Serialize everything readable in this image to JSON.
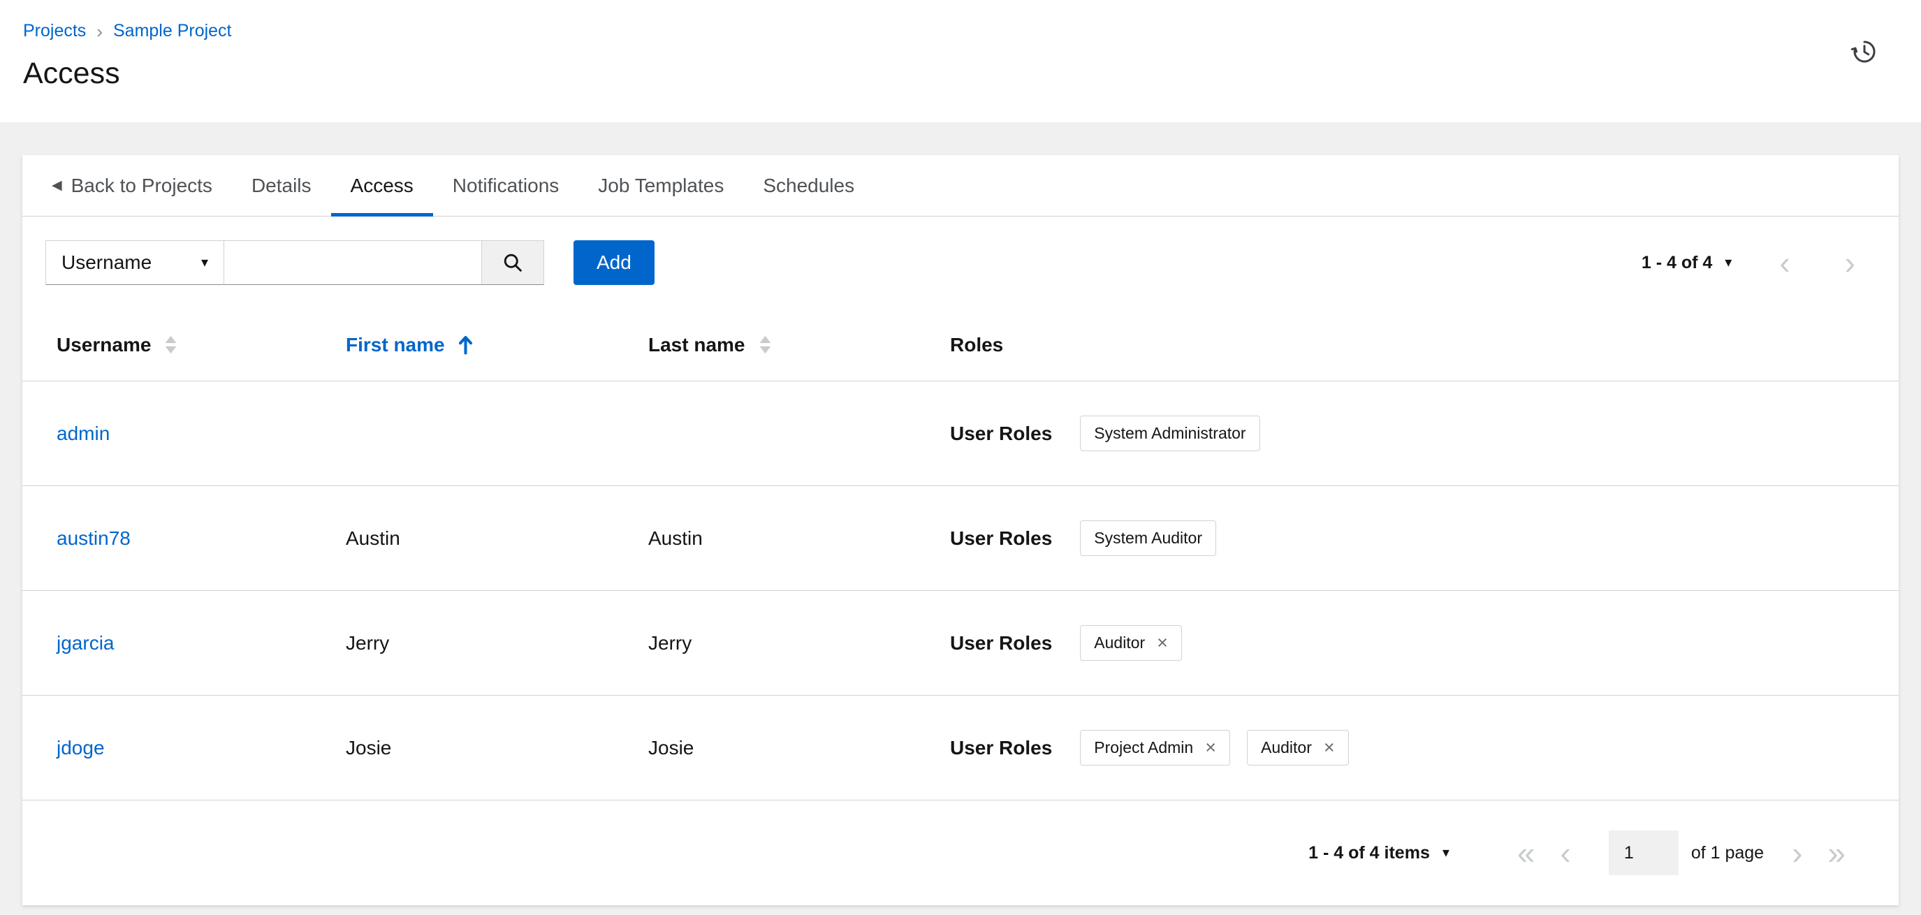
{
  "breadcrumb": {
    "projects": "Projects",
    "sample_project": "Sample Project"
  },
  "page": {
    "title": "Access"
  },
  "tabs": {
    "back": "Back to Projects",
    "details": "Details",
    "access": "Access",
    "notifications": "Notifications",
    "job_templates": "Job Templates",
    "schedules": "Schedules"
  },
  "toolbar": {
    "filter_selected": "Username",
    "search_value": "",
    "add_label": "Add",
    "range": "1 - 4 of 4"
  },
  "table": {
    "headers": {
      "username": "Username",
      "first_name": "First name",
      "last_name": "Last name",
      "roles": "Roles"
    },
    "rows": [
      {
        "username": "admin",
        "first_name": "",
        "last_name": "",
        "roles_label": "User Roles",
        "chips": [
          {
            "label": "System Administrator"
          }
        ]
      },
      {
        "username": "austin78",
        "first_name": "Austin",
        "last_name": "Austin",
        "roles_label": "User Roles",
        "chips": [
          {
            "label": "System Auditor"
          }
        ]
      },
      {
        "username": "jgarcia",
        "first_name": "Jerry",
        "last_name": "Jerry",
        "roles_label": "User Roles",
        "chips": [
          {
            "label": "Auditor",
            "removable": true
          }
        ]
      },
      {
        "username": "jdoge",
        "first_name": "Josie",
        "last_name": "Josie",
        "roles_label": "User Roles",
        "chips": [
          {
            "label": "Project Admin",
            "removable": true
          },
          {
            "label": "Auditor",
            "removable": true
          }
        ]
      }
    ]
  },
  "footer": {
    "range": "1 - 4 of 4 items",
    "current_page": "1",
    "page_of": "of 1 page"
  },
  "icons": {
    "breadcrumb_separator": "›",
    "back_caret": "◀",
    "caret_down": "▾",
    "chevron_left": "‹",
    "chevron_right": "›",
    "double_chevron_left": "«",
    "double_chevron_right": "»",
    "close": "×"
  },
  "colors": {
    "accent": "#0066cc",
    "link": "#0066cc",
    "border": "#d2d2d2",
    "background": "#f0f0f0"
  }
}
